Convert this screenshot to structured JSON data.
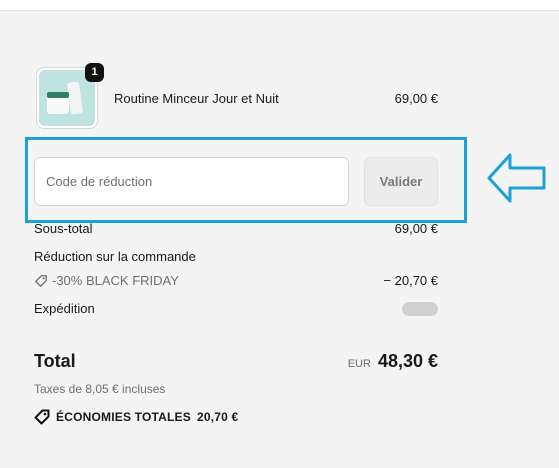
{
  "cart": {
    "item": {
      "name": "Routine Minceur Jour et Nuit",
      "price": "69,00 €",
      "quantity": "1",
      "image_icon": "product-thumbnail"
    }
  },
  "discount": {
    "placeholder": "Code de réduction",
    "value": "",
    "button_label": "Valider"
  },
  "summary": {
    "subtotal_label": "Sous-total",
    "subtotal_value": "69,00 €",
    "order_discount_label": "Réduction sur la commande",
    "discount_code": "-30% BLACK FRIDAY",
    "discount_value": "− 20,70 €",
    "shipping_label": "Expédition",
    "total_label": "Total",
    "total_currency": "EUR",
    "total_value": "48,30 €",
    "taxes_text": "Taxes de 8,05 € incluses",
    "savings_label": "ÉCONOMIES TOTALES",
    "savings_value": "20,70 €"
  },
  "colors": {
    "highlight": "#1aa3d9",
    "panel_bg": "#f4f4f5",
    "badge_bg": "#111111"
  },
  "icons": [
    "tag-icon",
    "tag-bold-icon",
    "left-arrow-annotation-icon"
  ]
}
